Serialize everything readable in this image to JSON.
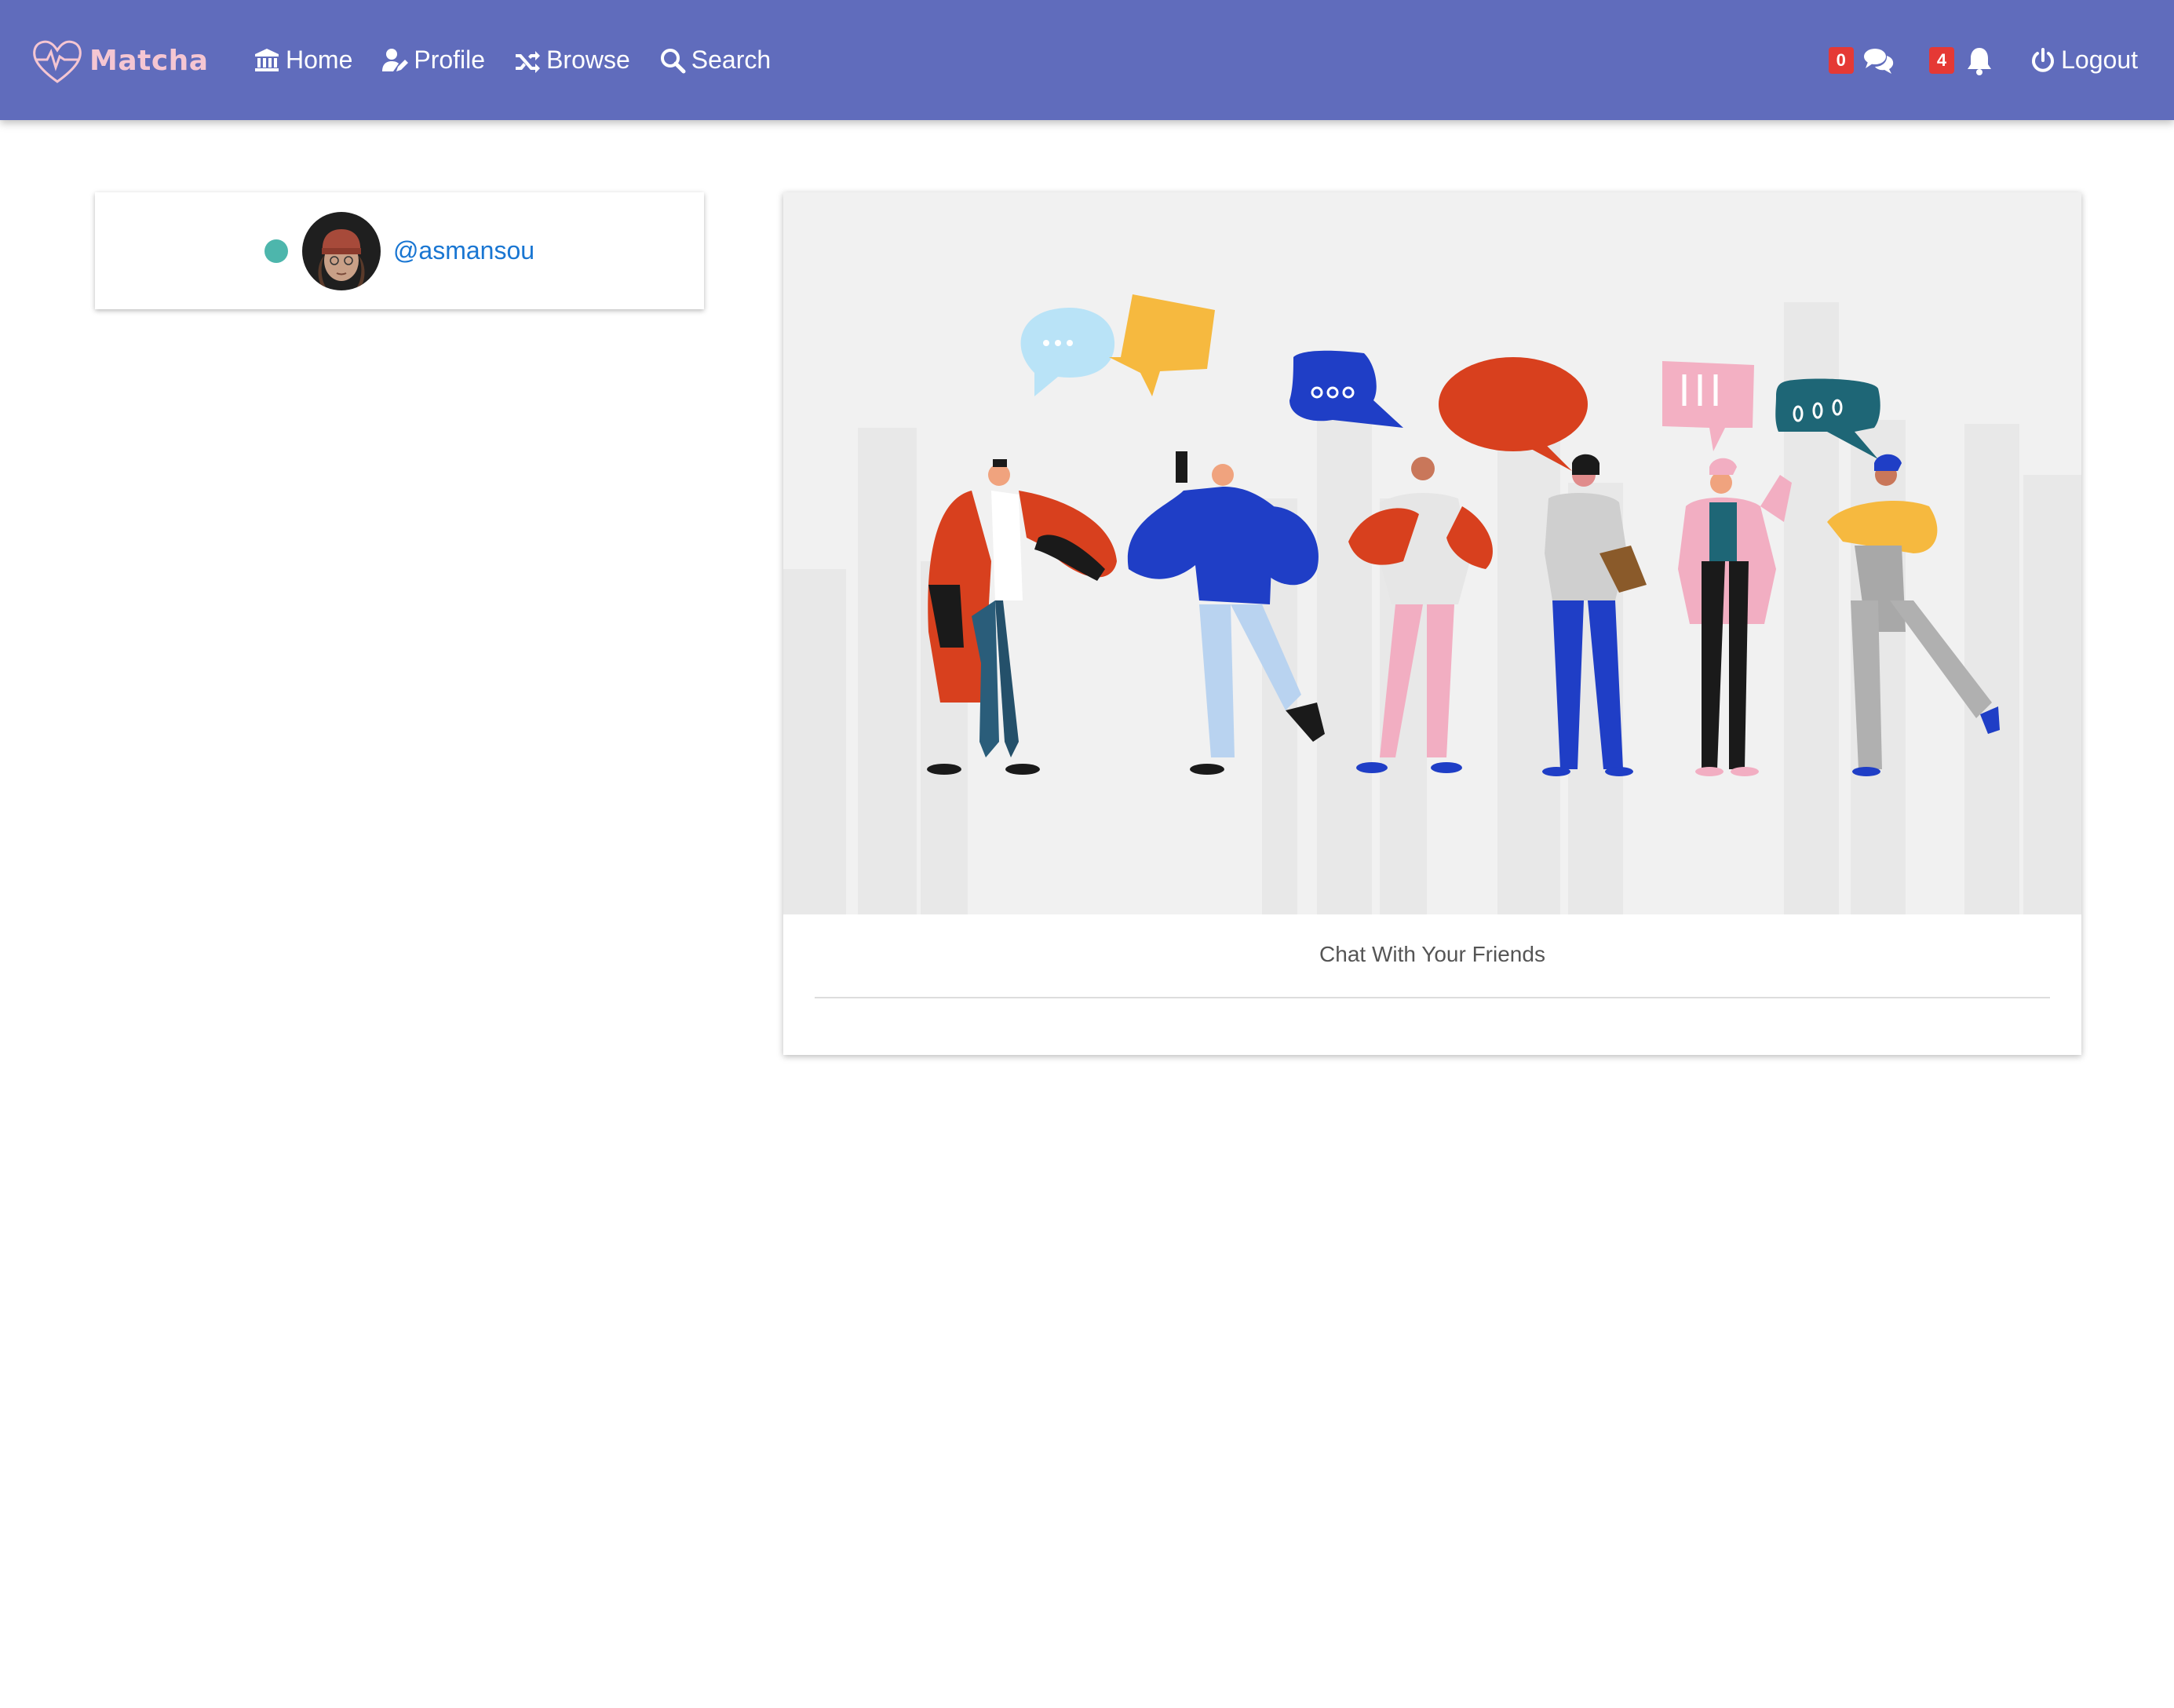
{
  "navbar": {
    "brand": "Matcha",
    "links": [
      {
        "label": "Home",
        "icon": "bank-icon"
      },
      {
        "label": "Profile",
        "icon": "user-edit-icon"
      },
      {
        "label": "Browse",
        "icon": "shuffle-icon"
      },
      {
        "label": "Search",
        "icon": "search-icon"
      }
    ],
    "messages_count": "0",
    "notifications_count": "4",
    "logout_label": "Logout"
  },
  "user_list": {
    "items": [
      {
        "username": "@asmansou",
        "status": "online",
        "status_color": "#4db6ac"
      }
    ]
  },
  "chat_panel": {
    "caption": "Chat With Your Friends"
  },
  "colors": {
    "navbar": "#606cbc",
    "brand": "#f5c6d2",
    "badge": "#e53935",
    "link": "#1976d2"
  }
}
